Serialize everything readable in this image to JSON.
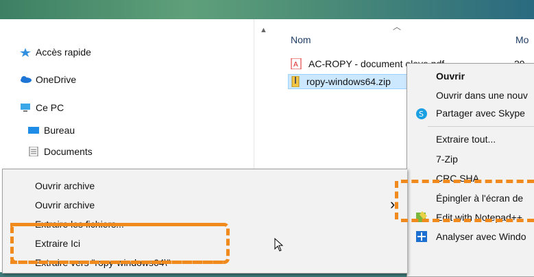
{
  "nav": {
    "items": [
      {
        "label": "Accès rapide",
        "icon": "star-icon"
      },
      {
        "label": "OneDrive",
        "icon": "cloud-icon"
      },
      {
        "label": "Ce PC",
        "icon": "computer-icon"
      },
      {
        "label": "Bureau",
        "icon": "desktop-icon"
      },
      {
        "label": "Documents",
        "icon": "documents-icon"
      }
    ]
  },
  "files": {
    "header_name": "Nom",
    "header_modified": "Mo",
    "rows": [
      {
        "name": "AC-ROPY - document eleve.pdf",
        "date": "29,",
        "icon": "pdf-icon"
      },
      {
        "name": "ropy-windows64.zip",
        "date": "",
        "icon": "zip-icon"
      }
    ]
  },
  "context_menu": {
    "items": [
      {
        "label": "Ouvrir"
      },
      {
        "label": "Ouvrir dans une nouv"
      },
      {
        "label": "Partager avec Skype",
        "icon": "skype-icon"
      },
      {
        "label": "Extraire tout..."
      },
      {
        "label": "7-Zip"
      },
      {
        "label": "CRC SHA"
      },
      {
        "label": "Épingler à l'écran de"
      },
      {
        "label": "Edit with Notepad++",
        "icon": "notepad-icon"
      },
      {
        "label": "Analyser avec Windo",
        "icon": "defender-icon"
      }
    ]
  },
  "submenu": {
    "items": [
      {
        "label": "Ouvrir archive"
      },
      {
        "label": "Ouvrir archive"
      },
      {
        "label": "Extraire les fichiers..."
      },
      {
        "label": "Extraire Ici"
      },
      {
        "label": "Extraire vers \"ropy-windows64\\\""
      }
    ],
    "arrow": "›"
  },
  "colors": {
    "highlight": "#f08a1c",
    "selection": "#cce8ff"
  }
}
